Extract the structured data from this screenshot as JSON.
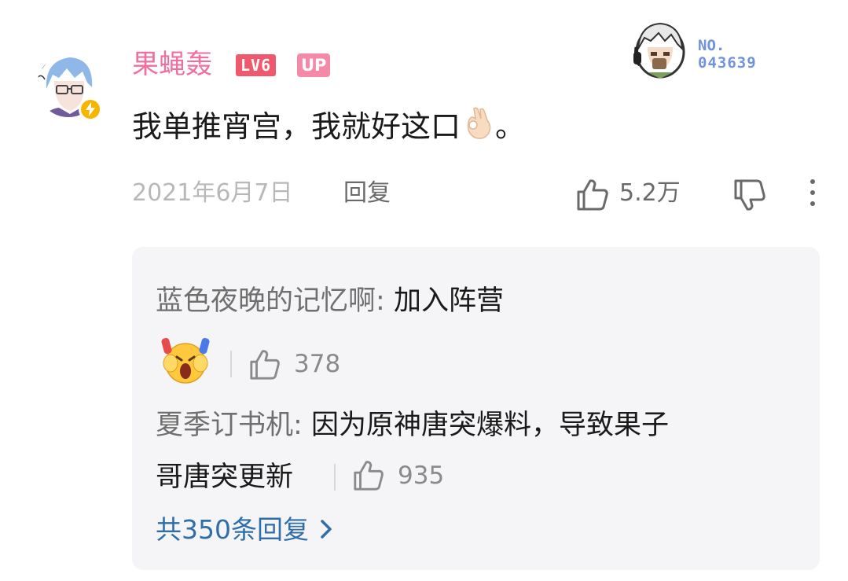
{
  "comment": {
    "username": "果蝇轰",
    "level_badge": "LV6",
    "up_badge": "UP",
    "fan_badge": {
      "label": "NO.",
      "number": "043639"
    },
    "text": "我单推宵宫，我就好这口",
    "text_end": "。",
    "emoji": "ok-hand-emoji",
    "date": "2021年6月7日",
    "reply_label": "回复",
    "like_count": "5.2万"
  },
  "replies": [
    {
      "user": "蓝色夜晚的记忆啊",
      "sep": ": ",
      "text": "加入阵营",
      "emoji": "screaming-face-emoji",
      "likes": "378"
    },
    {
      "user": "夏季订书机",
      "sep": ": ",
      "text_line1": "因为原神唐突爆料，导致果子",
      "text_line2": "哥唐突更新",
      "likes": "935"
    }
  ],
  "more_replies": "共350条回复",
  "colors": {
    "username": "#f06f9f",
    "level_badge": "#f0586e",
    "up_badge": "#f58aa8",
    "fan_number": "#6f93df",
    "link": "#2f6ea8",
    "reply_box_bg": "#f5f5f7"
  }
}
